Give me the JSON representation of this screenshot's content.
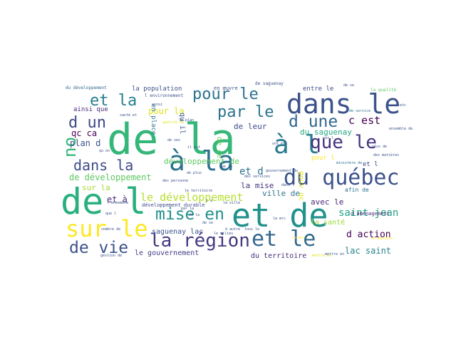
{
  "cloud": {
    "words": [
      {
        "text": "de la",
        "color": "#35b779"
      },
      {
        "text": "de l",
        "color": "#2ab07f"
      },
      {
        "text": "et de",
        "color": "#21918c"
      },
      {
        "text": "à la",
        "color": "#2c728e"
      },
      {
        "text": "dans le",
        "color": "#3b528b"
      },
      {
        "text": "et le",
        "color": "#31688e"
      },
      {
        "text": "du québec",
        "color": "#3b528b"
      },
      {
        "text": "sur le",
        "color": "#fde725"
      },
      {
        "text": "à l",
        "color": "#287c8e"
      },
      {
        "text": "la région",
        "color": "#443983"
      },
      {
        "text": "que le",
        "color": "#46337e"
      },
      {
        "text": "d une",
        "color": "#31688e"
      },
      {
        "text": "de vie",
        "color": "#3b528b"
      },
      {
        "text": "mise en",
        "color": "#21918c"
      },
      {
        "text": "pour le",
        "color": "#2c728e"
      },
      {
        "text": "par le",
        "color": "#2c728e"
      },
      {
        "text": "et la",
        "color": "#277f8e"
      },
      {
        "text": "ou",
        "color": "#35b779"
      },
      {
        "text": "d un",
        "color": "#3e4a89"
      },
      {
        "text": "dans la",
        "color": "#3e4a89"
      },
      {
        "text": "le développement",
        "color": "#b5de2b"
      },
      {
        "text": "saint jean",
        "color": "#20a386"
      },
      {
        "text": "c est",
        "color": "#440154"
      },
      {
        "text": "lac saint",
        "color": "#25848e"
      },
      {
        "text": "et d",
        "color": "#2c728e"
      },
      {
        "text": "d action",
        "color": "#440154"
      },
      {
        "text": "et à",
        "color": "#472d7b"
      },
      {
        "text": "de développement",
        "color": "#5ec962"
      },
      {
        "text": "pour la",
        "color": "#dde318"
      },
      {
        "text": "plan d",
        "color": "#3b528b"
      },
      {
        "text": "qc ca",
        "color": "#440154"
      },
      {
        "text": "du saguenay",
        "color": "#22a884"
      },
      {
        "text": "de leur",
        "color": "#3e4a89"
      },
      {
        "text": "sur la",
        "color": "#a5db36"
      },
      {
        "text": "la mise",
        "color": "#46337e"
      },
      {
        "text": "ville de",
        "color": "#2c728e"
      },
      {
        "text": "avec le",
        "color": "#482878"
      },
      {
        "text": "développement de",
        "color": "#5ec962"
      },
      {
        "text": "saguenay lac",
        "color": "#3b528b"
      },
      {
        "text": "du territoire",
        "color": "#472d7b"
      },
      {
        "text": "le gouvernement",
        "color": "#433e85"
      },
      {
        "text": "la santé",
        "color": "#a0da39"
      },
      {
        "text": "gouv qc",
        "color": "#dde318"
      },
      {
        "text": "la population",
        "color": "#3b528b"
      },
      {
        "text": "ainsi que",
        "color": "#472d7b"
      },
      {
        "text": "entre le",
        "color": "#3e4a89"
      },
      {
        "text": "pour l",
        "color": "#fde725"
      },
      {
        "text": "et l",
        "color": "#3e4a89"
      },
      {
        "text": "qu il",
        "color": "#3b528b"
      },
      {
        "text": "en place",
        "color": "#2c728e"
      },
      {
        "text": "afin de",
        "color": "#2c728e"
      },
      {
        "text": "de ce",
        "color": "#6ccd5a"
      },
      {
        "text": "d aménagement",
        "color": "#472d7b"
      },
      {
        "text": "développement durable",
        "color": "#3e4a89"
      },
      {
        "text": "en œuvre",
        "color": "#3b528b"
      },
      {
        "text": "de saguenay",
        "color": "#3b528b"
      },
      {
        "text": "la qualité",
        "color": "#5ec962"
      },
      {
        "text": "du développement",
        "color": "#31688e"
      },
      {
        "text": "l environnement",
        "color": "#3b528b"
      },
      {
        "text": "de se",
        "color": "#3e4a89"
      },
      {
        "text": "des services",
        "color": "#3b528b"
      },
      {
        "text": "de service",
        "color": "#2c728e"
      },
      {
        "text": "ministère de",
        "color": "#2c728e"
      },
      {
        "text": "des matières",
        "color": "#3b528b"
      },
      {
        "text": "d autre",
        "color": "#3b528b"
      },
      {
        "text": "tous le",
        "color": "#3b528b"
      },
      {
        "text": "la mrc",
        "color": "#fde725"
      },
      {
        "text": "en matière",
        "color": "#fde725"
      },
      {
        "text": "mettre en",
        "color": "#dde318"
      },
      {
        "text": "gestion de",
        "color": "#3b528b"
      },
      {
        "text": "nombre de",
        "color": "#3b528b"
      },
      {
        "text": "par la",
        "color": "#3b528b"
      },
      {
        "text": "la ville",
        "color": "#3b528b"
      },
      {
        "text": "le territoire",
        "color": "#3b528b"
      },
      {
        "text": "des personne",
        "color": "#3b528b"
      },
      {
        "text": "de plus",
        "color": "#3b528b"
      },
      {
        "text": "que la",
        "color": "#3b528b"
      },
      {
        "text": "dans l",
        "color": "#3b528b"
      },
      {
        "text": "l ensemble",
        "color": "#3b528b"
      },
      {
        "text": "plus de",
        "color": "#3b528b"
      },
      {
        "text": "etc",
        "color": "#3b528b"
      },
      {
        "text": "ont été",
        "color": "#3b528b"
      },
      {
        "text": "qualité de",
        "color": "#dde318"
      },
      {
        "text": "le plan",
        "color": "#3b528b"
      },
      {
        "text": "ainsi",
        "color": "#3b528b"
      },
      {
        "text": "ensemble de",
        "color": "#3b528b"
      },
      {
        "text": "mettre en",
        "color": "#3b528b"
      },
      {
        "text": "santé et",
        "color": "#3b528b"
      },
      {
        "text": "gouvernement du",
        "color": "#3b528b"
      },
      {
        "text": "le milieu",
        "color": "#3b528b"
      },
      {
        "text": "la mrc",
        "color": "#3b528b"
      },
      {
        "text": "que l",
        "color": "#3b528b"
      },
      {
        "text": "qu on",
        "color": "#3b528b"
      },
      {
        "text": "par l",
        "color": "#3b528b"
      },
      {
        "text": "de ses",
        "color": "#3b528b"
      },
      {
        "text": "il est",
        "color": "#3b528b"
      },
      {
        "text": "i a",
        "color": "#3b528b"
      },
      {
        "text": "de la",
        "color": "#3b528b"
      },
      {
        "text": "de se",
        "color": "#3b528b"
      }
    ]
  }
}
